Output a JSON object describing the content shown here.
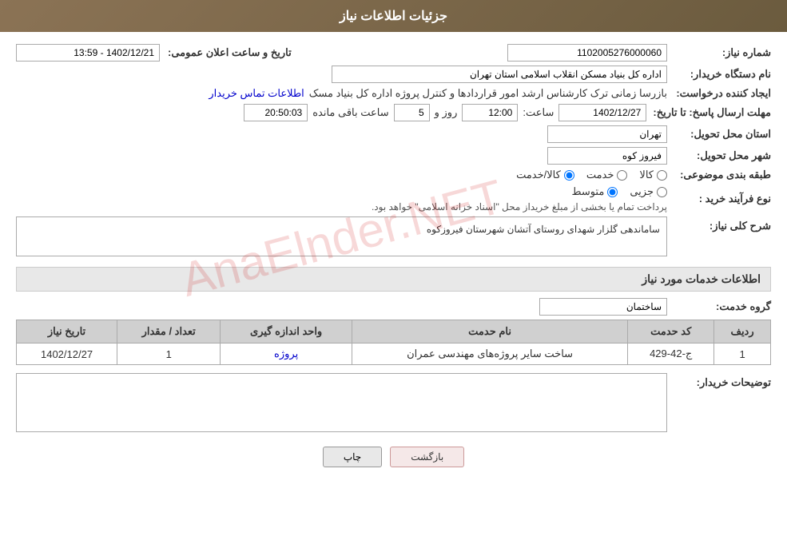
{
  "header": {
    "title": "جزئیات اطلاعات نیاز"
  },
  "fields": {
    "shmara_niaz_label": "شماره نیاز:",
    "shmara_niaz_value": "1102005276000060",
    "dastagah_label": "نام دستگاه خریدار:",
    "dastagah_value": "اداره کل بنیاد مسکن انقلاب اسلامی استان تهران",
    "creator_label": "ایجاد کننده درخواست:",
    "creator_value": "بازرسا زمانی ترک کارشناس ارشد امور قراردادها و کنترل پروژه اداره کل بنیاد مسک",
    "creator_link": "اطلاعات تماس خریدار",
    "deadline_label": "مهلت ارسال پاسخ: تا تاریخ:",
    "date_value": "1402/12/27",
    "time_label": "ساعت:",
    "time_value": "12:00",
    "days_label": "روز و",
    "days_value": "5",
    "remaining_label": "ساعت باقی مانده",
    "remaining_value": "20:50:03",
    "ostan_label": "استان محل تحویل:",
    "ostan_value": "تهران",
    "shahr_label": "شهر محل تحویل:",
    "shahr_value": "فیروز کوه",
    "classification_label": "طبقه بندی موضوعی:",
    "radio_kala": "کالا",
    "radio_khadamat": "خدمت",
    "radio_kala_khadamat": "کالا/خدمت",
    "naoe_farayand_label": "نوع فرآیند خرید :",
    "radio_jazii": "جزیی",
    "radio_moutavaset": "متوسط",
    "naoe_payment_text": "پرداخت تمام یا بخشی از مبلغ خریداز محل \"اسناد خزانه اسلامی\" خواهد بود.",
    "sharh_label": "شرح کلی نیاز:",
    "sharh_value": "ساماندهی گلزار شهدای روستای آتشان شهرستان فیروزکوه",
    "services_title": "اطلاعات خدمات مورد نیاز",
    "group_label": "گروه خدمت:",
    "group_value": "ساختمان",
    "table_headers": [
      "ردیف",
      "کد حدمت",
      "نام حدمت",
      "واحد اندازه گیری",
      "تعداد / مقدار",
      "تاریخ نیاز"
    ],
    "table_rows": [
      {
        "radif": "1",
        "code": "ج-42-429",
        "name": "ساخت سایر پروژه‌های مهندسی عمران",
        "unit": "پروژه",
        "quantity": "1",
        "date": "1402/12/27"
      }
    ],
    "buyer_notes_label": "توضیحات خریدار:",
    "buyer_notes_value": "",
    "btn_print": "چاپ",
    "btn_back": "بازگشت",
    "announce_label": "تاریخ و ساعت اعلان عمومی:",
    "announce_value": "1402/12/21 - 13:59",
    "col_detection": "Col"
  }
}
